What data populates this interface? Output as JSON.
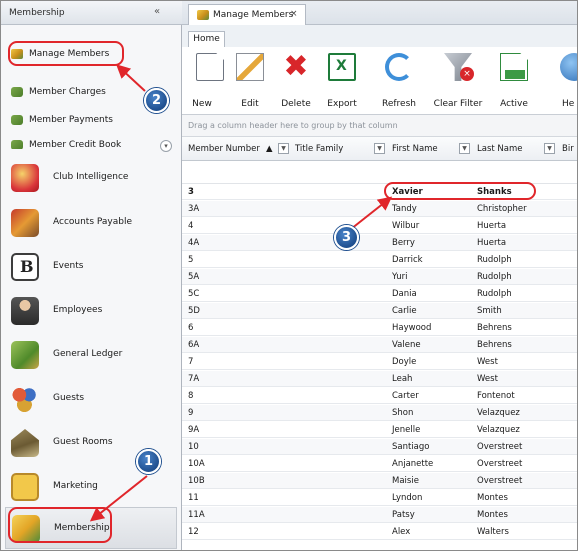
{
  "nav": {
    "title": "Membership",
    "collapse_glyph": "«",
    "scroll_glyph": "▾",
    "links": [
      {
        "label": "Manage Members",
        "icon": "members-icon"
      },
      {
        "label": "Member Charges",
        "icon": "charges-icon"
      },
      {
        "label": "Member Payments",
        "icon": "payments-icon"
      },
      {
        "label": "Member Credit Book",
        "icon": "credit-book-icon"
      }
    ],
    "modules": [
      {
        "label": "Club Intelligence",
        "icon": "club-intelligence-icon"
      },
      {
        "label": "Accounts Payable",
        "icon": "accounts-payable-icon"
      },
      {
        "label": "Events",
        "icon": "events-icon",
        "glyph": "B"
      },
      {
        "label": "Employees",
        "icon": "employees-icon"
      },
      {
        "label": "General Ledger",
        "icon": "general-ledger-icon"
      },
      {
        "label": "Guests",
        "icon": "guests-icon"
      },
      {
        "label": "Guest Rooms",
        "icon": "guest-rooms-icon"
      },
      {
        "label": "Marketing",
        "icon": "marketing-icon"
      },
      {
        "label": "Membership",
        "icon": "membership-icon"
      }
    ]
  },
  "doc_tab": {
    "label": "Manage Members",
    "close": "×"
  },
  "ribbon": {
    "tab": "Home",
    "buttons": [
      {
        "label": "New",
        "icon": "new-document-icon"
      },
      {
        "label": "Edit",
        "icon": "edit-icon"
      },
      {
        "label": "Delete",
        "icon": "delete-icon",
        "glyph": "✖"
      },
      {
        "label": "Export",
        "icon": "excel-export-icon",
        "glyph": "X"
      },
      {
        "label": "Refresh",
        "icon": "refresh-icon"
      },
      {
        "label": "Clear Filter",
        "icon": "clear-filter-icon",
        "glyph": "×"
      },
      {
        "label": "Active",
        "icon": "active-icon"
      },
      {
        "label": "He",
        "icon": "help-icon"
      }
    ]
  },
  "grid": {
    "group_hint": "Drag a column header here to group by that column",
    "columns": [
      "Member Number",
      "Title Family",
      "First Name",
      "Last Name",
      "Bir"
    ],
    "sort_glyph": "▲",
    "filter_glyph": "▼",
    "rows": [
      [
        "3",
        "Xavier",
        "Shanks"
      ],
      [
        "3A",
        "Tandy",
        "Christopher"
      ],
      [
        "4",
        "Wilbur",
        "Huerta"
      ],
      [
        "4A",
        "Berry",
        "Huerta"
      ],
      [
        "5",
        "Darrick",
        "Rudolph"
      ],
      [
        "5A",
        "Yuri",
        "Rudolph"
      ],
      [
        "5C",
        "Dania",
        "Rudolph"
      ],
      [
        "5D",
        "Carlie",
        "Smith"
      ],
      [
        "6",
        "Haywood",
        "Behrens"
      ],
      [
        "6A",
        "Valene",
        "Behrens"
      ],
      [
        "7",
        "Doyle",
        "West"
      ],
      [
        "7A",
        "Leah",
        "West"
      ],
      [
        "8",
        "Carter",
        "Fontenot"
      ],
      [
        "9",
        "Shon",
        "Velazquez"
      ],
      [
        "9A",
        "Jenelle",
        "Velazquez"
      ],
      [
        "10",
        "Santiago",
        "Overstreet"
      ],
      [
        "10A",
        "Anjanette",
        "Overstreet"
      ],
      [
        "10B",
        "Maisie",
        "Overstreet"
      ],
      [
        "11",
        "Lyndon",
        "Montes"
      ],
      [
        "11A",
        "Patsy",
        "Montes"
      ],
      [
        "12",
        "Alex",
        "Walters"
      ]
    ]
  },
  "callouts": [
    "1",
    "2",
    "3"
  ],
  "colors": {
    "callout": "#1f4f8f",
    "highlight": "#e0262b",
    "accent": "#3e8fd9"
  }
}
